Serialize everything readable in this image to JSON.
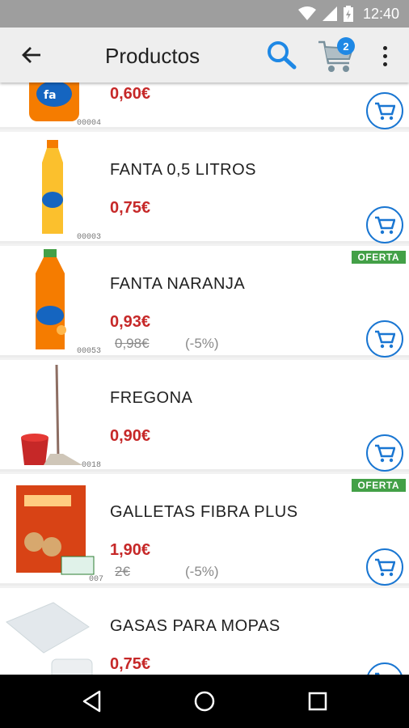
{
  "status_bar": {
    "time": "12:40",
    "icons": [
      "wifi-icon",
      "signal-icon",
      "battery-charging-icon"
    ]
  },
  "app_bar": {
    "title": "Productos",
    "back_icon": "arrow-back-icon",
    "search_icon": "search-icon",
    "cart_icon": "shopping-cart-icon",
    "cart_count": "2",
    "menu_icon": "more-vert-icon"
  },
  "products": [
    {
      "code": "00004",
      "name": "",
      "price": "0,60€",
      "offer": "",
      "old_price": "",
      "discount": "",
      "image": "fanta-can"
    },
    {
      "code": "00003",
      "name": "FANTA 0,5 LITROS",
      "price": "0,75€",
      "offer": "",
      "old_price": "",
      "discount": "",
      "image": "fanta-lemon-bottle"
    },
    {
      "code": "00053",
      "name": "FANTA NARANJA",
      "price": "0,93€",
      "offer": "OFERTA",
      "old_price": "0,98€",
      "discount": "(-5%)",
      "image": "fanta-orange-bottle"
    },
    {
      "code": "0018",
      "name": "FREGONA",
      "price": "0,90€",
      "offer": "",
      "old_price": "",
      "discount": "",
      "image": "mop-bucket"
    },
    {
      "code": "007",
      "name": "GALLETAS FIBRA PLUS",
      "price": "1,90€",
      "offer": "OFERTA",
      "old_price": "2€",
      "discount": "(-5%)",
      "image": "cookie-box"
    },
    {
      "code": "",
      "name": "GASAS PARA MOPAS",
      "price": "0,75€",
      "offer": "",
      "old_price": "",
      "discount": "",
      "image": "mop-gauze"
    }
  ],
  "nav_bar": {
    "back_icon": "nav-back-icon",
    "home_icon": "nav-home-icon",
    "recents_icon": "nav-recents-icon"
  },
  "colors": {
    "price": "#c62828",
    "offer_badge": "#43a047",
    "accent": "#1976d2",
    "app_bar": "#eeeeee",
    "status_bar": "#9e9e9e"
  }
}
